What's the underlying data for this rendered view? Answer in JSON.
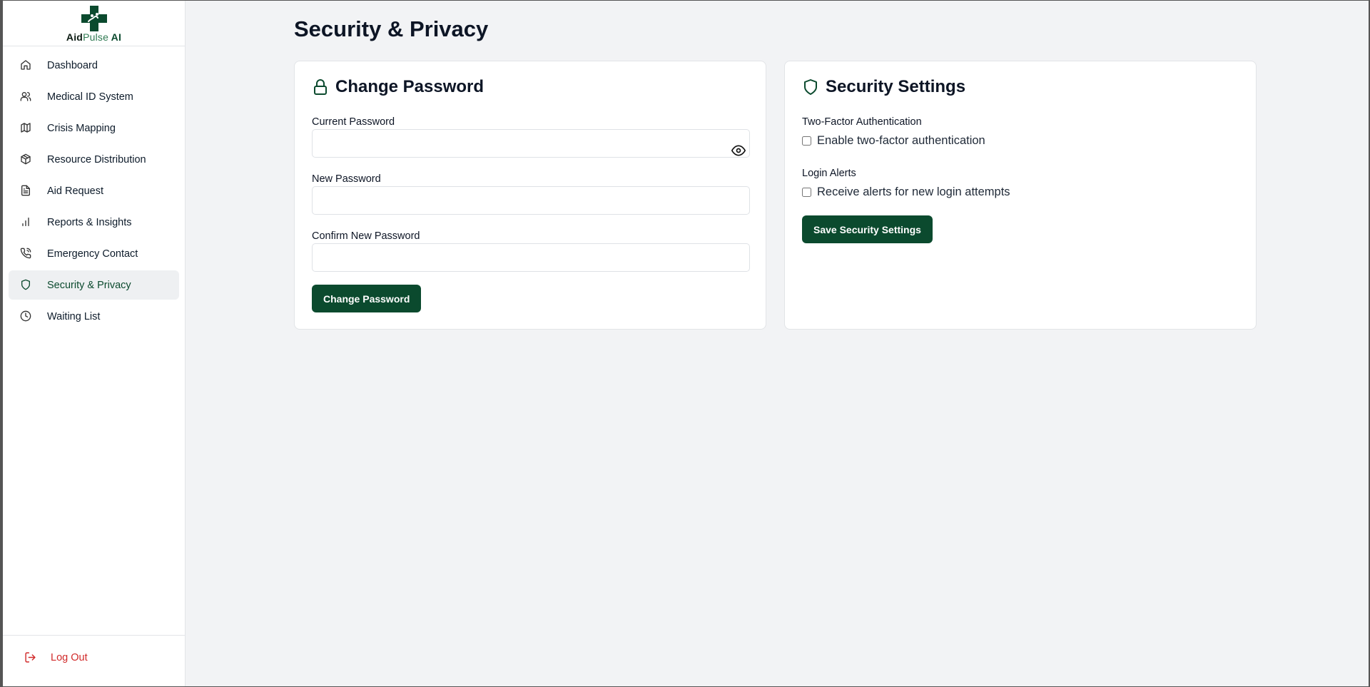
{
  "brand": {
    "name_part1": "Aid",
    "name_part2": "Pulse",
    "name_part3": " AI",
    "accent_color": "#0b4a2e"
  },
  "sidebar": {
    "items": [
      {
        "label": "Dashboard",
        "icon": "home-icon",
        "active": false
      },
      {
        "label": "Medical ID System",
        "icon": "users-icon",
        "active": false
      },
      {
        "label": "Crisis Mapping",
        "icon": "map-icon",
        "active": false
      },
      {
        "label": "Resource Distribution",
        "icon": "package-icon",
        "active": false
      },
      {
        "label": "Aid Request",
        "icon": "file-text-icon",
        "active": false
      },
      {
        "label": "Reports & Insights",
        "icon": "bar-chart-icon",
        "active": false
      },
      {
        "label": "Emergency Contact",
        "icon": "phone-call-icon",
        "active": false
      },
      {
        "label": "Security & Privacy",
        "icon": "shield-icon",
        "active": true
      },
      {
        "label": "Waiting List",
        "icon": "clock-icon",
        "active": false
      }
    ],
    "logout_label": "Log Out"
  },
  "page": {
    "title": "Security & Privacy"
  },
  "change_password": {
    "title": "Change Password",
    "current_label": "Current Password",
    "current_value": "",
    "new_label": "New Password",
    "new_value": "",
    "confirm_label": "Confirm New Password",
    "confirm_value": "",
    "submit_label": "Change Password"
  },
  "security_settings": {
    "title": "Security Settings",
    "two_factor_heading": "Two-Factor Authentication",
    "two_factor_option": "Enable two-factor authentication",
    "two_factor_checked": false,
    "login_alerts_heading": "Login Alerts",
    "login_alerts_option": "Receive alerts for new login attempts",
    "login_alerts_checked": false,
    "save_label": "Save Security Settings"
  }
}
